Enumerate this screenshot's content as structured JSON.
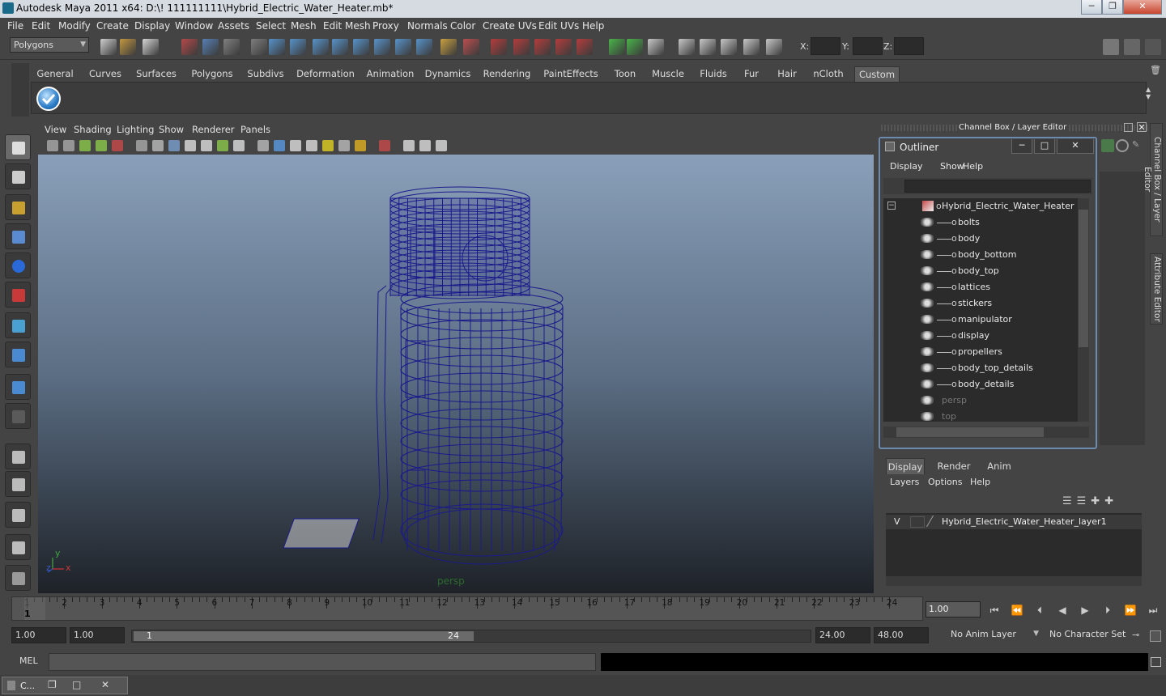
{
  "window": {
    "title": "Autodesk Maya 2011 x64: D:\\! 111111111\\Hybrid_Electric_Water_Heater.mb*",
    "min": "─",
    "max": "❐",
    "close": "✕"
  },
  "menubar": [
    "File",
    "Edit",
    "Modify",
    "Create",
    "Display",
    "Window",
    "Assets",
    "Select",
    "Mesh",
    "Edit Mesh",
    "Proxy",
    "Normals",
    "Color",
    "Create UVs",
    "Edit UVs",
    "Help"
  ],
  "status": {
    "mode": "Polygons",
    "x_label": "X:",
    "y_label": "Y:",
    "z_label": "Z:"
  },
  "shelf_tabs": [
    "General",
    "Curves",
    "Surfaces",
    "Polygons",
    "Subdivs",
    "Deformation",
    "Animation",
    "Dynamics",
    "Rendering",
    "PaintEffects",
    "Toon",
    "Muscle",
    "Fluids",
    "Fur",
    "Hair",
    "nCloth",
    "Custom"
  ],
  "shelf_active": "Custom",
  "viewport": {
    "menu": [
      "View",
      "Shading",
      "Lighting",
      "Show",
      "Renderer",
      "Panels"
    ],
    "camera_label": "persp",
    "axis_y": "y",
    "axis_x": "x",
    "axis_z": "z",
    "wire_color": "#1a1a8a"
  },
  "channel_box": {
    "title": "Channel Box / Layer Editor"
  },
  "side_tabs": {
    "channel": "Channel Box / Layer Editor",
    "attribute": "Attribute Editor"
  },
  "outliner": {
    "title": "Outliner",
    "menu": [
      "Display",
      "Show",
      "Help"
    ],
    "root": "Hybrid_Electric_Water_Heater",
    "children": [
      "bolts",
      "body",
      "body_bottom",
      "body_top",
      "lattices",
      "stickers",
      "manipulator",
      "display",
      "propellers",
      "body_top_details",
      "body_details"
    ],
    "cameras": [
      "persp",
      "top"
    ]
  },
  "layer_editor": {
    "tabs": [
      "Display",
      "Render",
      "Anim"
    ],
    "active": "Display",
    "menu": [
      "Layers",
      "Options",
      "Help"
    ],
    "layer": {
      "visible": "V",
      "name": "Hybrid_Electric_Water_Heater_layer1"
    }
  },
  "timeline": {
    "frames": [
      "1",
      "2",
      "3",
      "4",
      "5",
      "6",
      "7",
      "8",
      "9",
      "10",
      "11",
      "12",
      "13",
      "14",
      "15",
      "16",
      "17",
      "18",
      "19",
      "20",
      "21",
      "22",
      "23",
      "24"
    ],
    "current": "1",
    "current_field": "1.00"
  },
  "range": {
    "start": "1.00",
    "start2": "1.00",
    "slider_start": "1",
    "slider_end": "24",
    "end": "24.00",
    "end2": "48.00",
    "anim_layer": "No Anim Layer",
    "char_set": "No Character Set"
  },
  "mel": {
    "label": "MEL"
  },
  "taskbar": {
    "label": "C..."
  }
}
